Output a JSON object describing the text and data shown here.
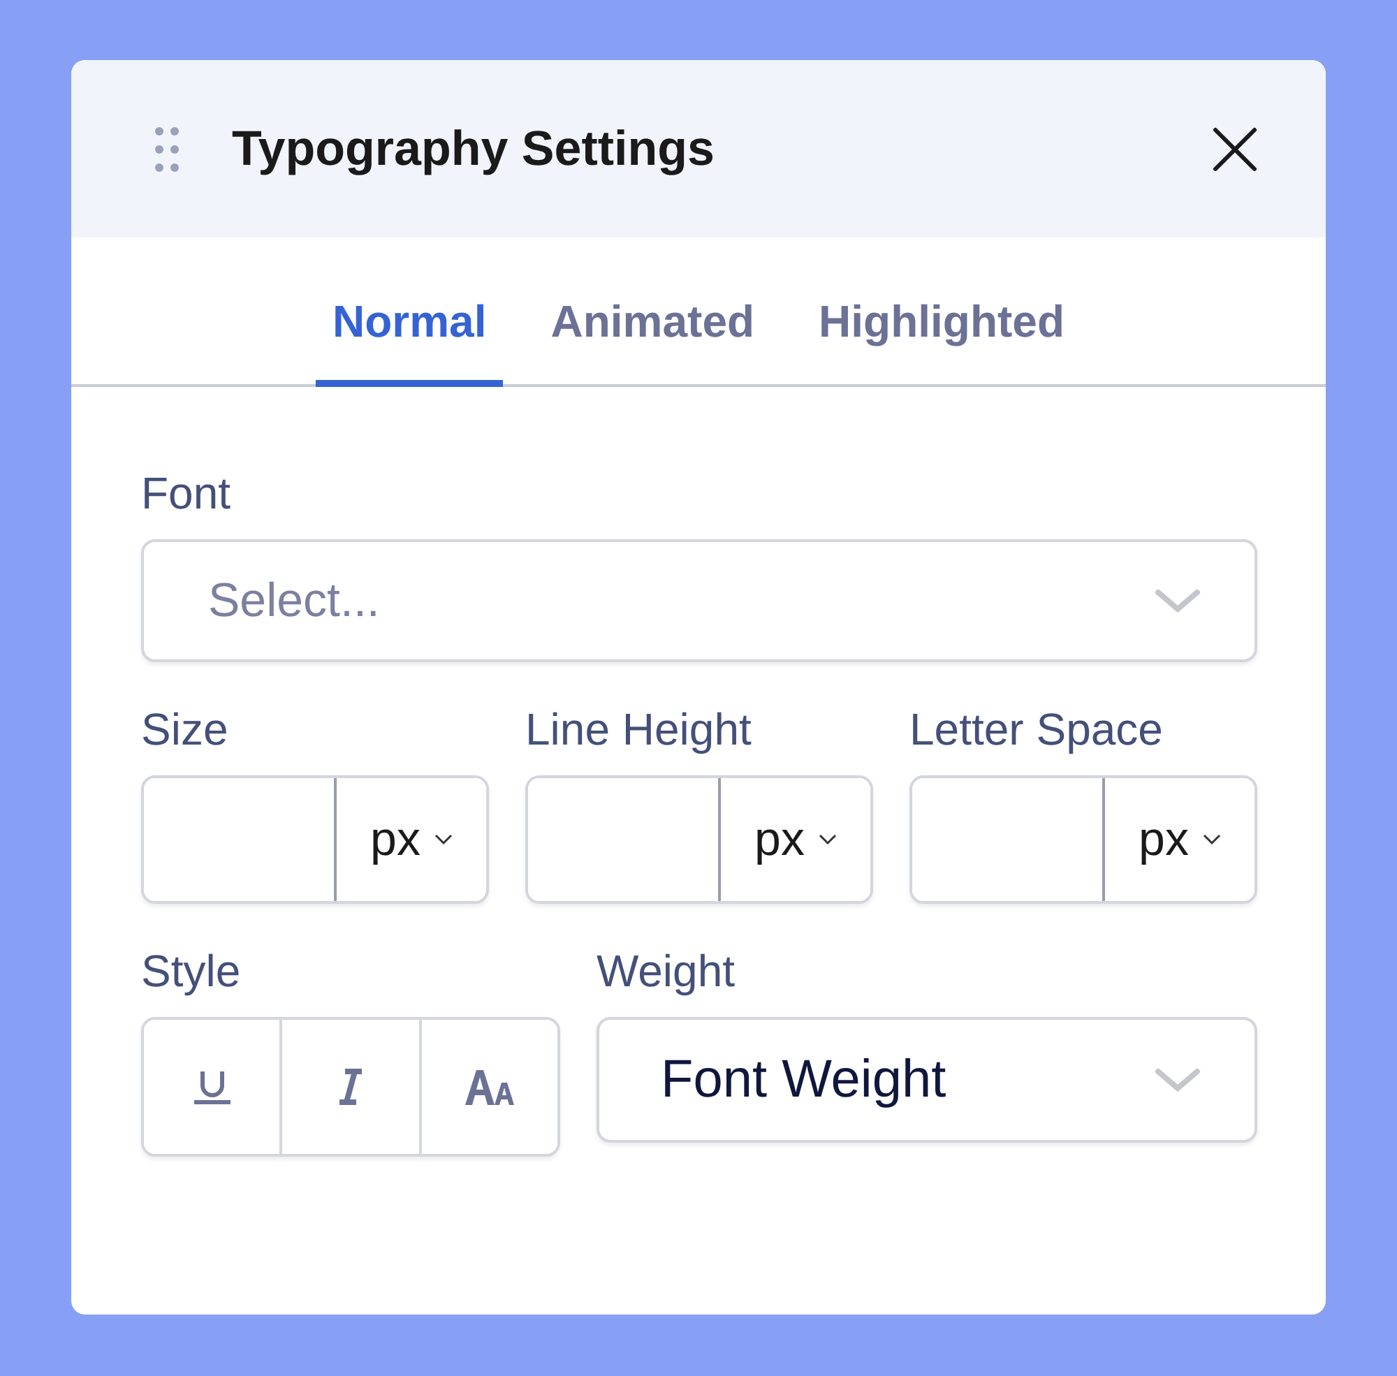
{
  "panel": {
    "title": "Typography Settings"
  },
  "tabs": [
    {
      "label": "Normal",
      "selected": true
    },
    {
      "label": "Animated",
      "selected": false
    },
    {
      "label": "Highlighted",
      "selected": false
    }
  ],
  "font": {
    "label": "Font",
    "placeholder": "Select..."
  },
  "measures": [
    {
      "label": "Size",
      "unit": "px"
    },
    {
      "label": "Line Height",
      "unit": "px"
    },
    {
      "label": "Letter Space",
      "unit": "px"
    }
  ],
  "style": {
    "label": "Style",
    "buttons": [
      {
        "kind": "underline"
      },
      {
        "kind": "italic"
      },
      {
        "kind": "case"
      }
    ]
  },
  "weight": {
    "label": "Weight",
    "value": "Font Weight"
  }
}
